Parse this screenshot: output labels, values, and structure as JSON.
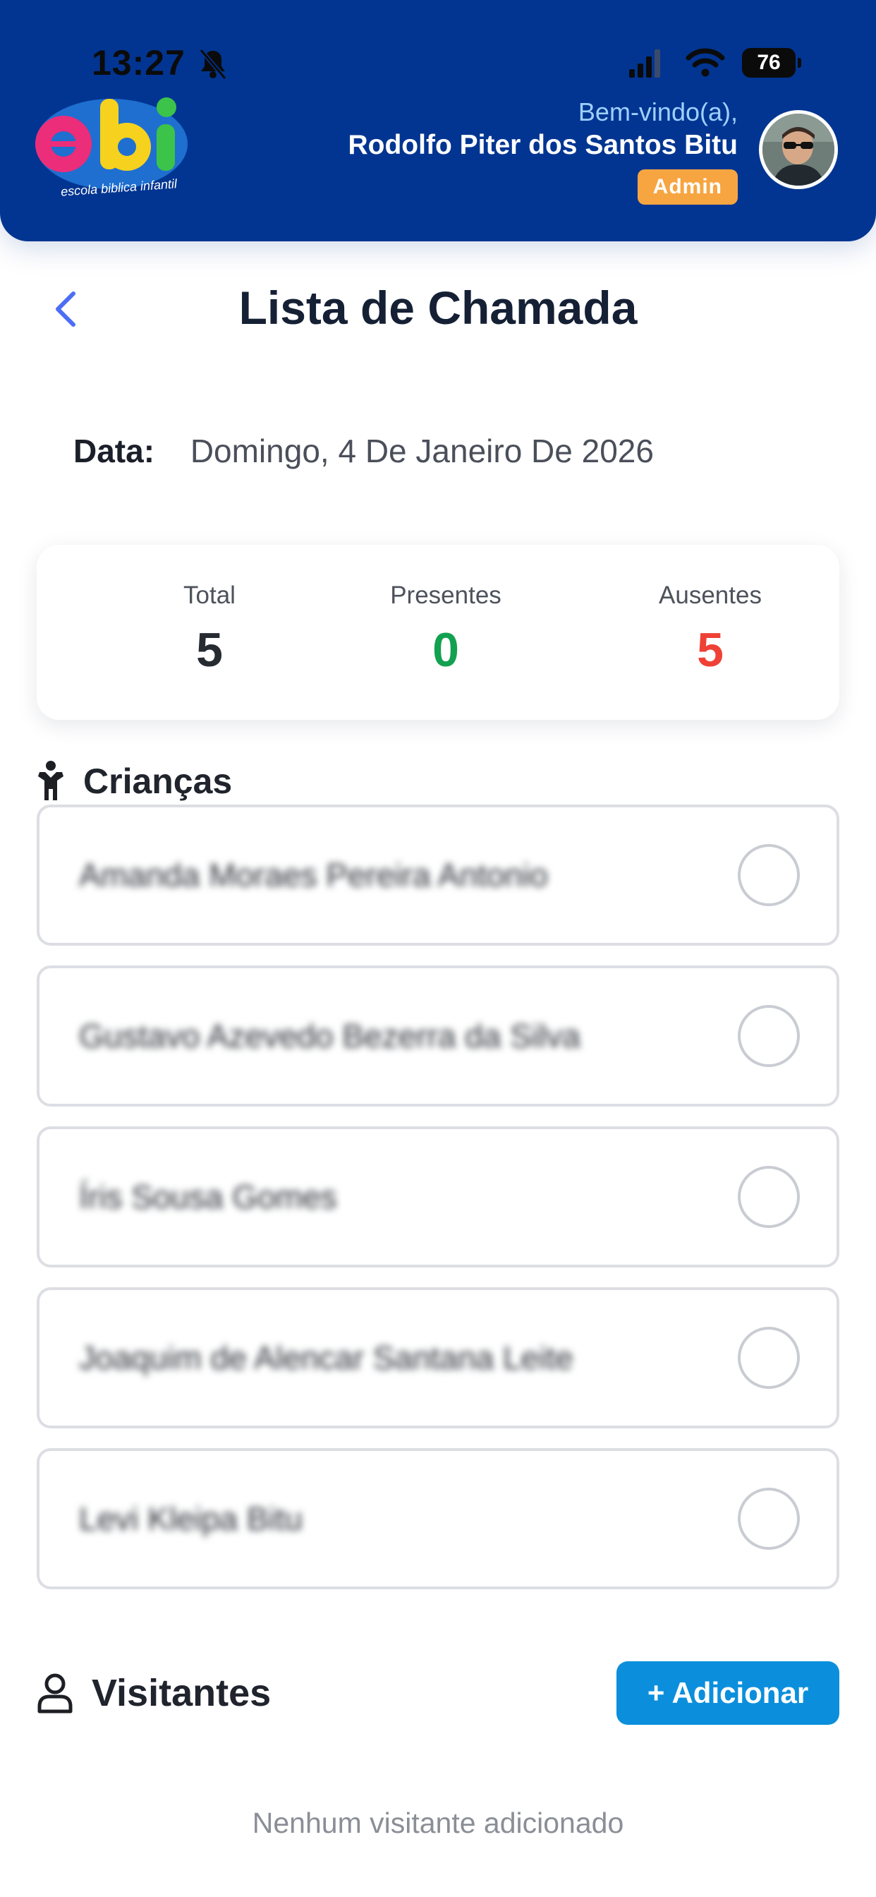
{
  "status_bar": {
    "time": "13:27",
    "battery": "76"
  },
  "header": {
    "logo_text": "ebi",
    "logo_subtitle": "escola biblica infantil",
    "welcome": "Bem-vindo(a),",
    "user_name": "Rodolfo Piter dos Santos Bitu",
    "role_badge": "Admin"
  },
  "page": {
    "title": "Lista de Chamada",
    "date_label": "Data:",
    "date_value": "Domingo, 4 De Janeiro De 2026"
  },
  "summary": {
    "total_label": "Total",
    "total_value": "5",
    "present_label": "Presentes",
    "present_value": "0",
    "absent_label": "Ausentes",
    "absent_value": "5"
  },
  "children": {
    "title": "Crianças",
    "items": [
      {
        "name": "Amanda Moraes Pereira Antonio",
        "present": false
      },
      {
        "name": "Gustavo Azevedo Bezerra da Silva",
        "present": false
      },
      {
        "name": "Íris Sousa Gomes",
        "present": false
      },
      {
        "name": "Joaquim de Alencar Santana Leite",
        "present": false
      },
      {
        "name": "Levi Kleipa Bitu",
        "present": false
      }
    ]
  },
  "visitors": {
    "title": "Visitantes",
    "add_label": "+ Adicionar",
    "empty_text": "Nenhum visitante adicionado"
  },
  "colors": {
    "header_bg": "#023591",
    "admin_badge": "#f7a541",
    "present": "#12a150",
    "absent": "#ef4136",
    "accent_button": "#0b8fdc",
    "back_arrow": "#4c6ef5"
  },
  "icons": [
    "bell-off-icon",
    "signal-icon",
    "wifi-icon",
    "battery-icon",
    "back-chevron-icon",
    "child-icon",
    "user-outline-icon"
  ]
}
